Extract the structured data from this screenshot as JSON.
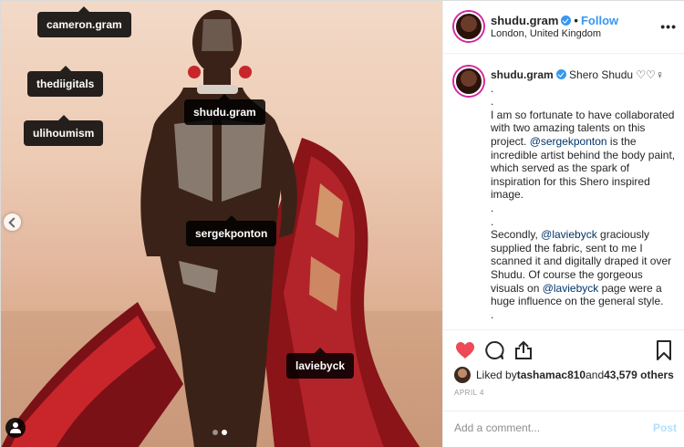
{
  "media": {
    "tags": [
      {
        "label": "cameron.gram"
      },
      {
        "label": "thediigitals"
      },
      {
        "label": "ulihoumism"
      },
      {
        "label": "shudu.gram"
      },
      {
        "label": "sergekponton"
      },
      {
        "label": "laviebyck"
      }
    ],
    "carousel_total": 2,
    "carousel_active": 2
  },
  "header": {
    "username": "shudu.gram",
    "separator": "•",
    "follow_label": "Follow",
    "location": "London, United Kingdom",
    "more_label": "•••"
  },
  "caption": {
    "username": "shudu.gram",
    "first_line": "Shero Shudu ♡♡♀",
    "dot1": ".",
    "dot2": ".",
    "para1_a": "I am so fortunate to have collaborated with two amazing talents on this project. ",
    "mention1": "@sergekponton",
    "para1_b": " is the incredible artist behind the body paint, which served as the spark of inspiration for this Shero inspired image.",
    "dot3": ".",
    "dot4": ".",
    "para2_a": "Secondly, ",
    "mention2": "@laviebyck",
    "para2_b": " graciously supplied the fabric, sent to me I scanned it and digitally draped it over Shudu. Of course the gorgeous visuals on ",
    "mention3": "@laviebyck",
    "para2_c": " page were a huge influence on the general style.",
    "dot5": "."
  },
  "actions": {
    "liked_by_prefix": "Liked by ",
    "liked_by_user": "tashamac810",
    "liked_and": " and ",
    "liked_count": "43,579 others",
    "date": "APRIL 4"
  },
  "comment_box": {
    "placeholder": "Add a comment...",
    "post_label": "Post"
  },
  "colors": {
    "accent": "#3897f0",
    "heart": "#ed4956",
    "mention": "#003569"
  }
}
